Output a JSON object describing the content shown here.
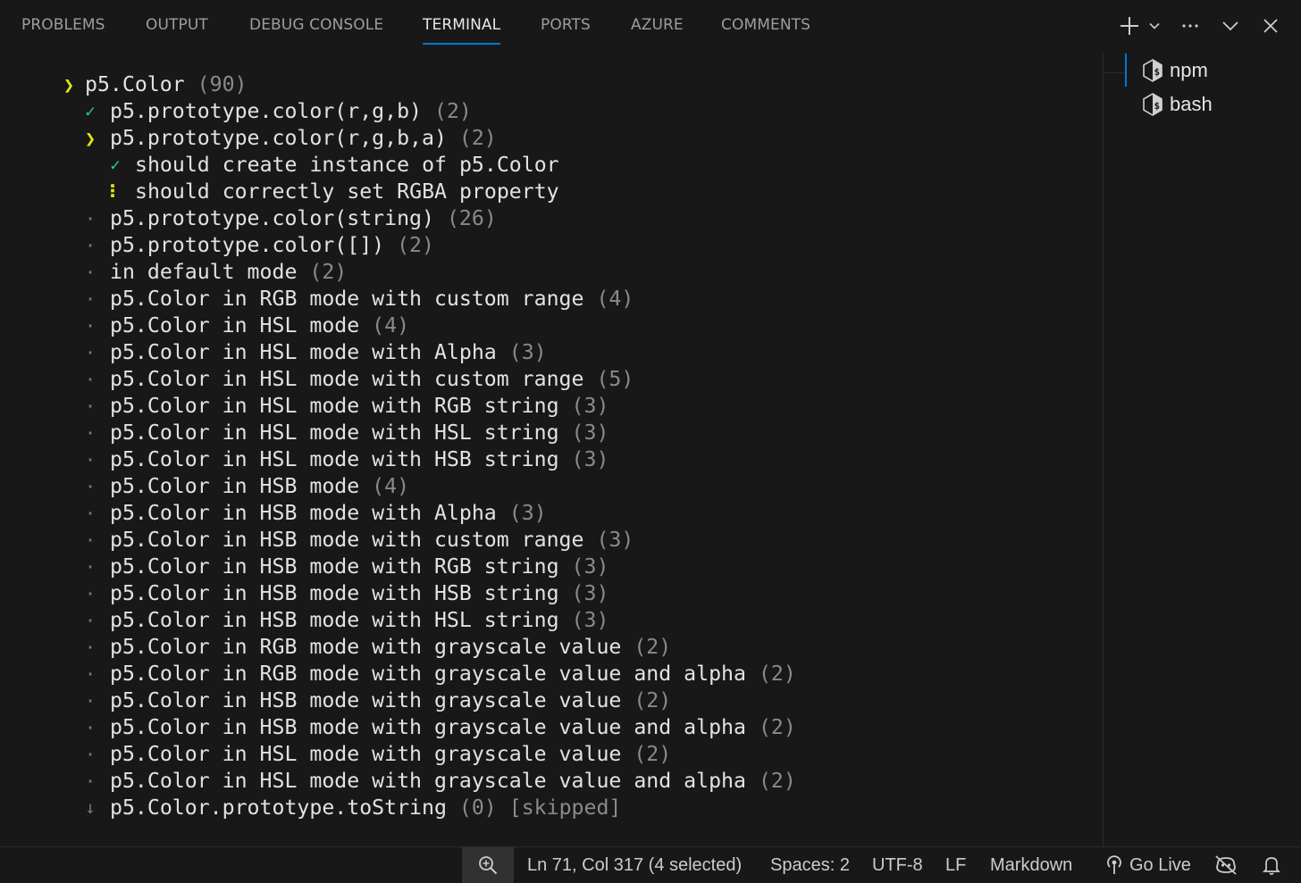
{
  "panel": {
    "tabs": [
      {
        "label": "PROBLEMS"
      },
      {
        "label": "OUTPUT"
      },
      {
        "label": "DEBUG CONSOLE"
      },
      {
        "label": "TERMINAL",
        "active": true
      },
      {
        "label": "PORTS"
      },
      {
        "label": "AZURE"
      },
      {
        "label": "COMMENTS"
      }
    ],
    "actions": [
      "plus-icon",
      "chevron-down-icon",
      "ellipsis-icon",
      "chevron-down-icon",
      "close-icon"
    ]
  },
  "terminal": {
    "lines": [
      {
        "marker": "❯",
        "kind": "chevron",
        "text": "p5.Color",
        "count": "(90)"
      },
      {
        "marker": "✓",
        "kind": "check",
        "text": "p5.prototype.color(r,g,b)",
        "count": "(2)"
      },
      {
        "marker": "❯",
        "kind": "chevron",
        "text": "p5.prototype.color(r,g,b,a)",
        "count": "(2)"
      },
      {
        "marker": "✓",
        "kind": "check",
        "text": "should create instance of p5.Color",
        "count": ""
      },
      {
        "marker": "⠇",
        "kind": "dots",
        "text": "should correctly set RGBA property",
        "count": ""
      },
      {
        "marker": "·",
        "kind": "dot",
        "text": "p5.prototype.color(string)",
        "count": "(26)"
      },
      {
        "marker": "·",
        "kind": "dot",
        "text": "p5.prototype.color([])",
        "count": "(2)"
      },
      {
        "marker": "·",
        "kind": "dot",
        "text": "in default mode",
        "count": "(2)"
      },
      {
        "marker": "·",
        "kind": "dot",
        "text": "p5.Color in RGB mode with custom range",
        "count": "(4)"
      },
      {
        "marker": "·",
        "kind": "dot",
        "text": "p5.Color in HSL mode",
        "count": "(4)"
      },
      {
        "marker": "·",
        "kind": "dot",
        "text": "p5.Color in HSL mode with Alpha",
        "count": "(3)"
      },
      {
        "marker": "·",
        "kind": "dot",
        "text": "p5.Color in HSL mode with custom range",
        "count": "(5)"
      },
      {
        "marker": "·",
        "kind": "dot",
        "text": "p5.Color in HSL mode with RGB string",
        "count": "(3)"
      },
      {
        "marker": "·",
        "kind": "dot",
        "text": "p5.Color in HSL mode with HSL string",
        "count": "(3)"
      },
      {
        "marker": "·",
        "kind": "dot",
        "text": "p5.Color in HSL mode with HSB string",
        "count": "(3)"
      },
      {
        "marker": "·",
        "kind": "dot",
        "text": "p5.Color in HSB mode",
        "count": "(4)"
      },
      {
        "marker": "·",
        "kind": "dot",
        "text": "p5.Color in HSB mode with Alpha",
        "count": "(3)"
      },
      {
        "marker": "·",
        "kind": "dot",
        "text": "p5.Color in HSB mode with custom range",
        "count": "(3)"
      },
      {
        "marker": "·",
        "kind": "dot",
        "text": "p5.Color in HSB mode with RGB string",
        "count": "(3)"
      },
      {
        "marker": "·",
        "kind": "dot",
        "text": "p5.Color in HSB mode with HSB string",
        "count": "(3)"
      },
      {
        "marker": "·",
        "kind": "dot",
        "text": "p5.Color in HSB mode with HSL string",
        "count": "(3)"
      },
      {
        "marker": "·",
        "kind": "dot",
        "text": "p5.Color in RGB mode with grayscale value",
        "count": "(2)"
      },
      {
        "marker": "·",
        "kind": "dot",
        "text": "p5.Color in RGB mode with grayscale value and alpha",
        "count": "(2)"
      },
      {
        "marker": "·",
        "kind": "dot",
        "text": "p5.Color in HSB mode with grayscale value",
        "count": "(2)"
      },
      {
        "marker": "·",
        "kind": "dot",
        "text": "p5.Color in HSB mode with grayscale value and alpha",
        "count": "(2)"
      },
      {
        "marker": "·",
        "kind": "dot",
        "text": "p5.Color in HSL mode with grayscale value",
        "count": "(2)"
      },
      {
        "marker": "·",
        "kind": "dot",
        "text": "p5.Color in HSL mode with grayscale value and alpha",
        "count": "(2)"
      },
      {
        "marker": "↓",
        "kind": "skip",
        "text": "p5.Color.prototype.toString",
        "count": "(0)",
        "suffix": "[skipped]"
      }
    ]
  },
  "terminal_list": {
    "items": [
      {
        "label": "npm",
        "icon": "terminal-shell-icon",
        "selected": true
      },
      {
        "label": "bash",
        "icon": "terminal-shell-icon",
        "selected": false
      }
    ]
  },
  "statusbar": {
    "left_fragment": ")",
    "zoom_icon": "zoom-in-icon",
    "cursor_position": "Ln 71, Col 317 (4 selected)",
    "indentation": "Spaces: 2",
    "encoding": "UTF-8",
    "eol": "LF",
    "language": "Markdown",
    "go_live": "Go Live",
    "go_live_icon": "broadcast-icon",
    "copilot_icon": "copilot-disabled-icon",
    "bell_icon": "bell-icon"
  },
  "colors": {
    "accent": "#0078d4",
    "background": "#181818",
    "pass": "#23d18b",
    "running": "#e5e510",
    "muted": "#8a8a8a"
  }
}
